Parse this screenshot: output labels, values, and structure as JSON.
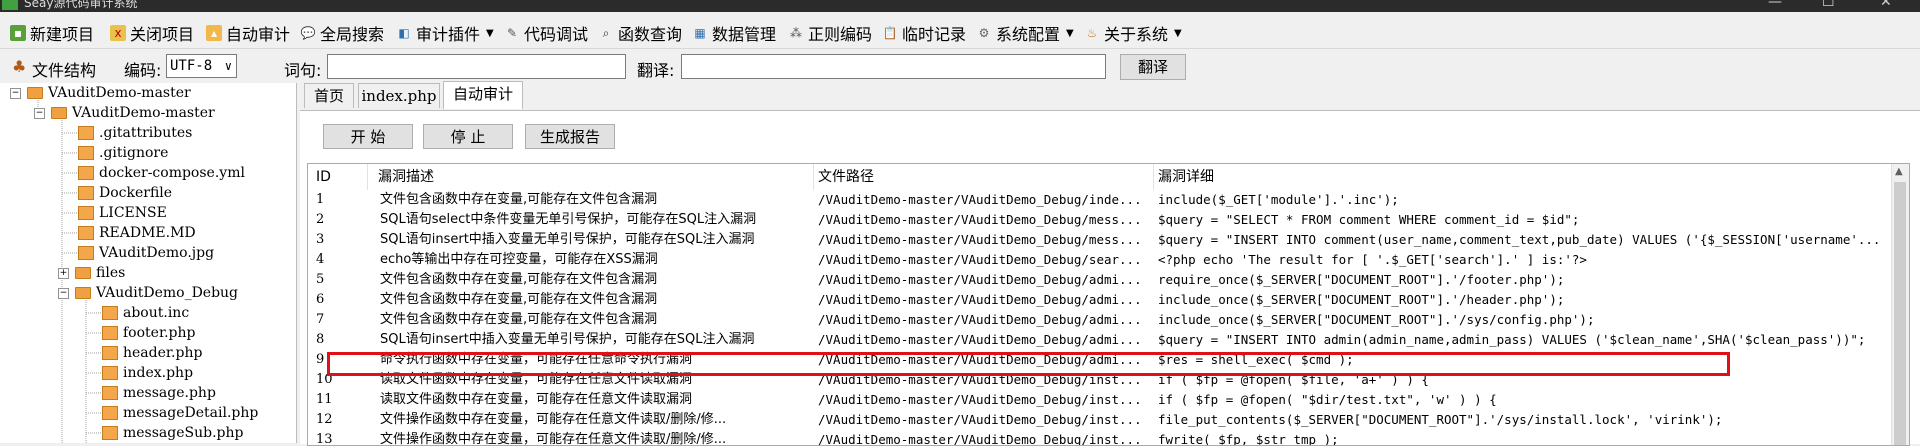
{
  "window": {
    "title": "Seay源代码审计系统"
  },
  "menu": {
    "items": [
      {
        "label": "新建项目",
        "icon": "new-project-icon"
      },
      {
        "label": "关闭项目",
        "icon": "close-project-icon"
      },
      {
        "label": "自动审计",
        "icon": "auto-audit-icon"
      },
      {
        "label": "全局搜索",
        "icon": "global-search-icon"
      },
      {
        "label": "审计插件",
        "icon": "plugin-icon",
        "dropdown": true
      },
      {
        "label": "代码调试",
        "icon": "debug-icon"
      },
      {
        "label": "函数查询",
        "icon": "function-search-icon"
      },
      {
        "label": "数据管理",
        "icon": "data-manage-icon"
      },
      {
        "label": "正则编码",
        "icon": "regex-encode-icon"
      },
      {
        "label": "临时记录",
        "icon": "temp-record-icon"
      },
      {
        "label": "系统配置",
        "icon": "gear-icon",
        "dropdown": true
      },
      {
        "label": "关于系统",
        "icon": "about-icon",
        "dropdown": true
      }
    ]
  },
  "toolbar": {
    "file_structure_label": "文件结构",
    "encoding_label": "编码:",
    "encoding_value": "UTF-8",
    "keyword_label": "词句:",
    "keyword_value": "",
    "translate_label": "翻译:",
    "translate_value": "",
    "translate_button": "翻译"
  },
  "tree": {
    "items": [
      {
        "label": "VAuditDemo-master",
        "type": "folder",
        "level": 0,
        "expanded": true
      },
      {
        "label": "VAuditDemo-master",
        "type": "folder",
        "level": 1,
        "expanded": true
      },
      {
        "label": ".gitattributes",
        "type": "file",
        "level": 2
      },
      {
        "label": ".gitignore",
        "type": "file",
        "level": 2
      },
      {
        "label": "docker-compose.yml",
        "type": "file",
        "level": 2
      },
      {
        "label": "Dockerfile",
        "type": "file",
        "level": 2
      },
      {
        "label": "LICENSE",
        "type": "file",
        "level": 2
      },
      {
        "label": "README.MD",
        "type": "file",
        "level": 2
      },
      {
        "label": "VAuditDemo.jpg",
        "type": "file",
        "level": 2
      },
      {
        "label": "files",
        "type": "folder",
        "level": 2,
        "expanded": false
      },
      {
        "label": "VAuditDemo_Debug",
        "type": "folder",
        "level": 2,
        "expanded": true
      },
      {
        "label": "about.inc",
        "type": "file",
        "level": 3
      },
      {
        "label": "footer.php",
        "type": "file",
        "level": 3
      },
      {
        "label": "header.php",
        "type": "file",
        "level": 3
      },
      {
        "label": "index.php",
        "type": "file",
        "level": 3
      },
      {
        "label": "message.php",
        "type": "file",
        "level": 3
      },
      {
        "label": "messageDetail.php",
        "type": "file",
        "level": 3
      },
      {
        "label": "messageSub.php",
        "type": "file",
        "level": 3
      }
    ]
  },
  "tabs": [
    {
      "label": "首页"
    },
    {
      "label": "index.php"
    },
    {
      "label": "自动审计",
      "active": true
    }
  ],
  "audit": {
    "start_button": "开 始",
    "stop_button": "停 止",
    "report_button": "生成报告"
  },
  "grid": {
    "headers": [
      "ID",
      "漏洞描述",
      "文件路径",
      "漏洞详细"
    ],
    "rows": [
      {
        "id": "1",
        "desc": "文件包含函数中存在变量,可能存在文件包含漏洞",
        "path": "/VAuditDemo-master/VAuditDemo_Debug/inde...",
        "detail": "include($_GET['module'].'.inc');"
      },
      {
        "id": "2",
        "desc": "SQL语句select中条件变量无单引号保护，可能存在SQL注入漏洞",
        "path": "/VAuditDemo-master/VAuditDemo_Debug/mess...",
        "detail": "$query = \"SELECT * FROM comment WHERE comment_id = $id\";"
      },
      {
        "id": "3",
        "desc": "SQL语句insert中插入变量无单引号保护，可能存在SQL注入漏洞",
        "path": "/VAuditDemo-master/VAuditDemo_Debug/mess...",
        "detail": "$query = \"INSERT INTO comment(user_name,comment_text,pub_date) VALUES ('{$_SESSION['username'..."
      },
      {
        "id": "4",
        "desc": "echo等输出中存在可控变量，可能存在XSS漏洞",
        "path": "/VAuditDemo-master/VAuditDemo_Debug/sear...",
        "detail": "<?php echo 'The result for [ '.$_GET['search'].' ] is:'?>"
      },
      {
        "id": "5",
        "desc": "文件包含函数中存在变量,可能存在文件包含漏洞",
        "path": "/VAuditDemo-master/VAuditDemo_Debug/admi...",
        "detail": "require_once($_SERVER[\"DOCUMENT_ROOT\"].'/footer.php');"
      },
      {
        "id": "6",
        "desc": "文件包含函数中存在变量,可能存在文件包含漏洞",
        "path": "/VAuditDemo-master/VAuditDemo_Debug/admi...",
        "detail": "include_once($_SERVER[\"DOCUMENT_ROOT\"].'/header.php');"
      },
      {
        "id": "7",
        "desc": "文件包含函数中存在变量,可能存在文件包含漏洞",
        "path": "/VAuditDemo-master/VAuditDemo_Debug/admi...",
        "detail": "include_once($_SERVER[\"DOCUMENT_ROOT\"].'/sys/config.php');"
      },
      {
        "id": "8",
        "desc": "SQL语句insert中插入变量无单引号保护，可能存在SQL注入漏洞",
        "path": "/VAuditDemo-master/VAuditDemo_Debug/admi...",
        "detail": "$query = \"INSERT INTO admin(admin_name,admin_pass) VALUES ('$clean_name',SHA('$clean_pass'))\";"
      },
      {
        "id": "9",
        "desc": "命令执行函数中存在变量，可能存在任意命令执行漏洞",
        "path": "/VAuditDemo-master/VAuditDemo_Debug/admi...",
        "detail": "$res = shell_exec( $cmd );"
      },
      {
        "id": "10",
        "desc": "读取文件函数中存在变量，可能存在任意文件读取漏洞",
        "path": "/VAuditDemo-master/VAuditDemo_Debug/inst...",
        "detail": "if ( $fp = @fopen( $file, 'a+' ) ) {"
      },
      {
        "id": "11",
        "desc": "读取文件函数中存在变量，可能存在任意文件读取漏洞",
        "path": "/VAuditDemo-master/VAuditDemo_Debug/inst...",
        "detail": "if ( $fp = @fopen( \"$dir/test.txt\", 'w' ) ) {"
      },
      {
        "id": "12",
        "desc": "文件操作函数中存在变量，可能存在任意文件读取/删除/修...",
        "path": "/VAuditDemo-master/VAuditDemo_Debug/inst...",
        "detail": "file_put_contents($_SERVER[\"DOCUMENT_ROOT\"].'/sys/install.lock', 'virink');"
      },
      {
        "id": "13",
        "desc": "文件操作函数中存在变量，可能存在任意文件读取/删除/修...",
        "path": "/VAuditDemo-master/VAuditDemo_Debug/inst...",
        "detail": "fwrite( $fp, $str_tmp );"
      }
    ]
  },
  "highlight_color": "#e0101a"
}
